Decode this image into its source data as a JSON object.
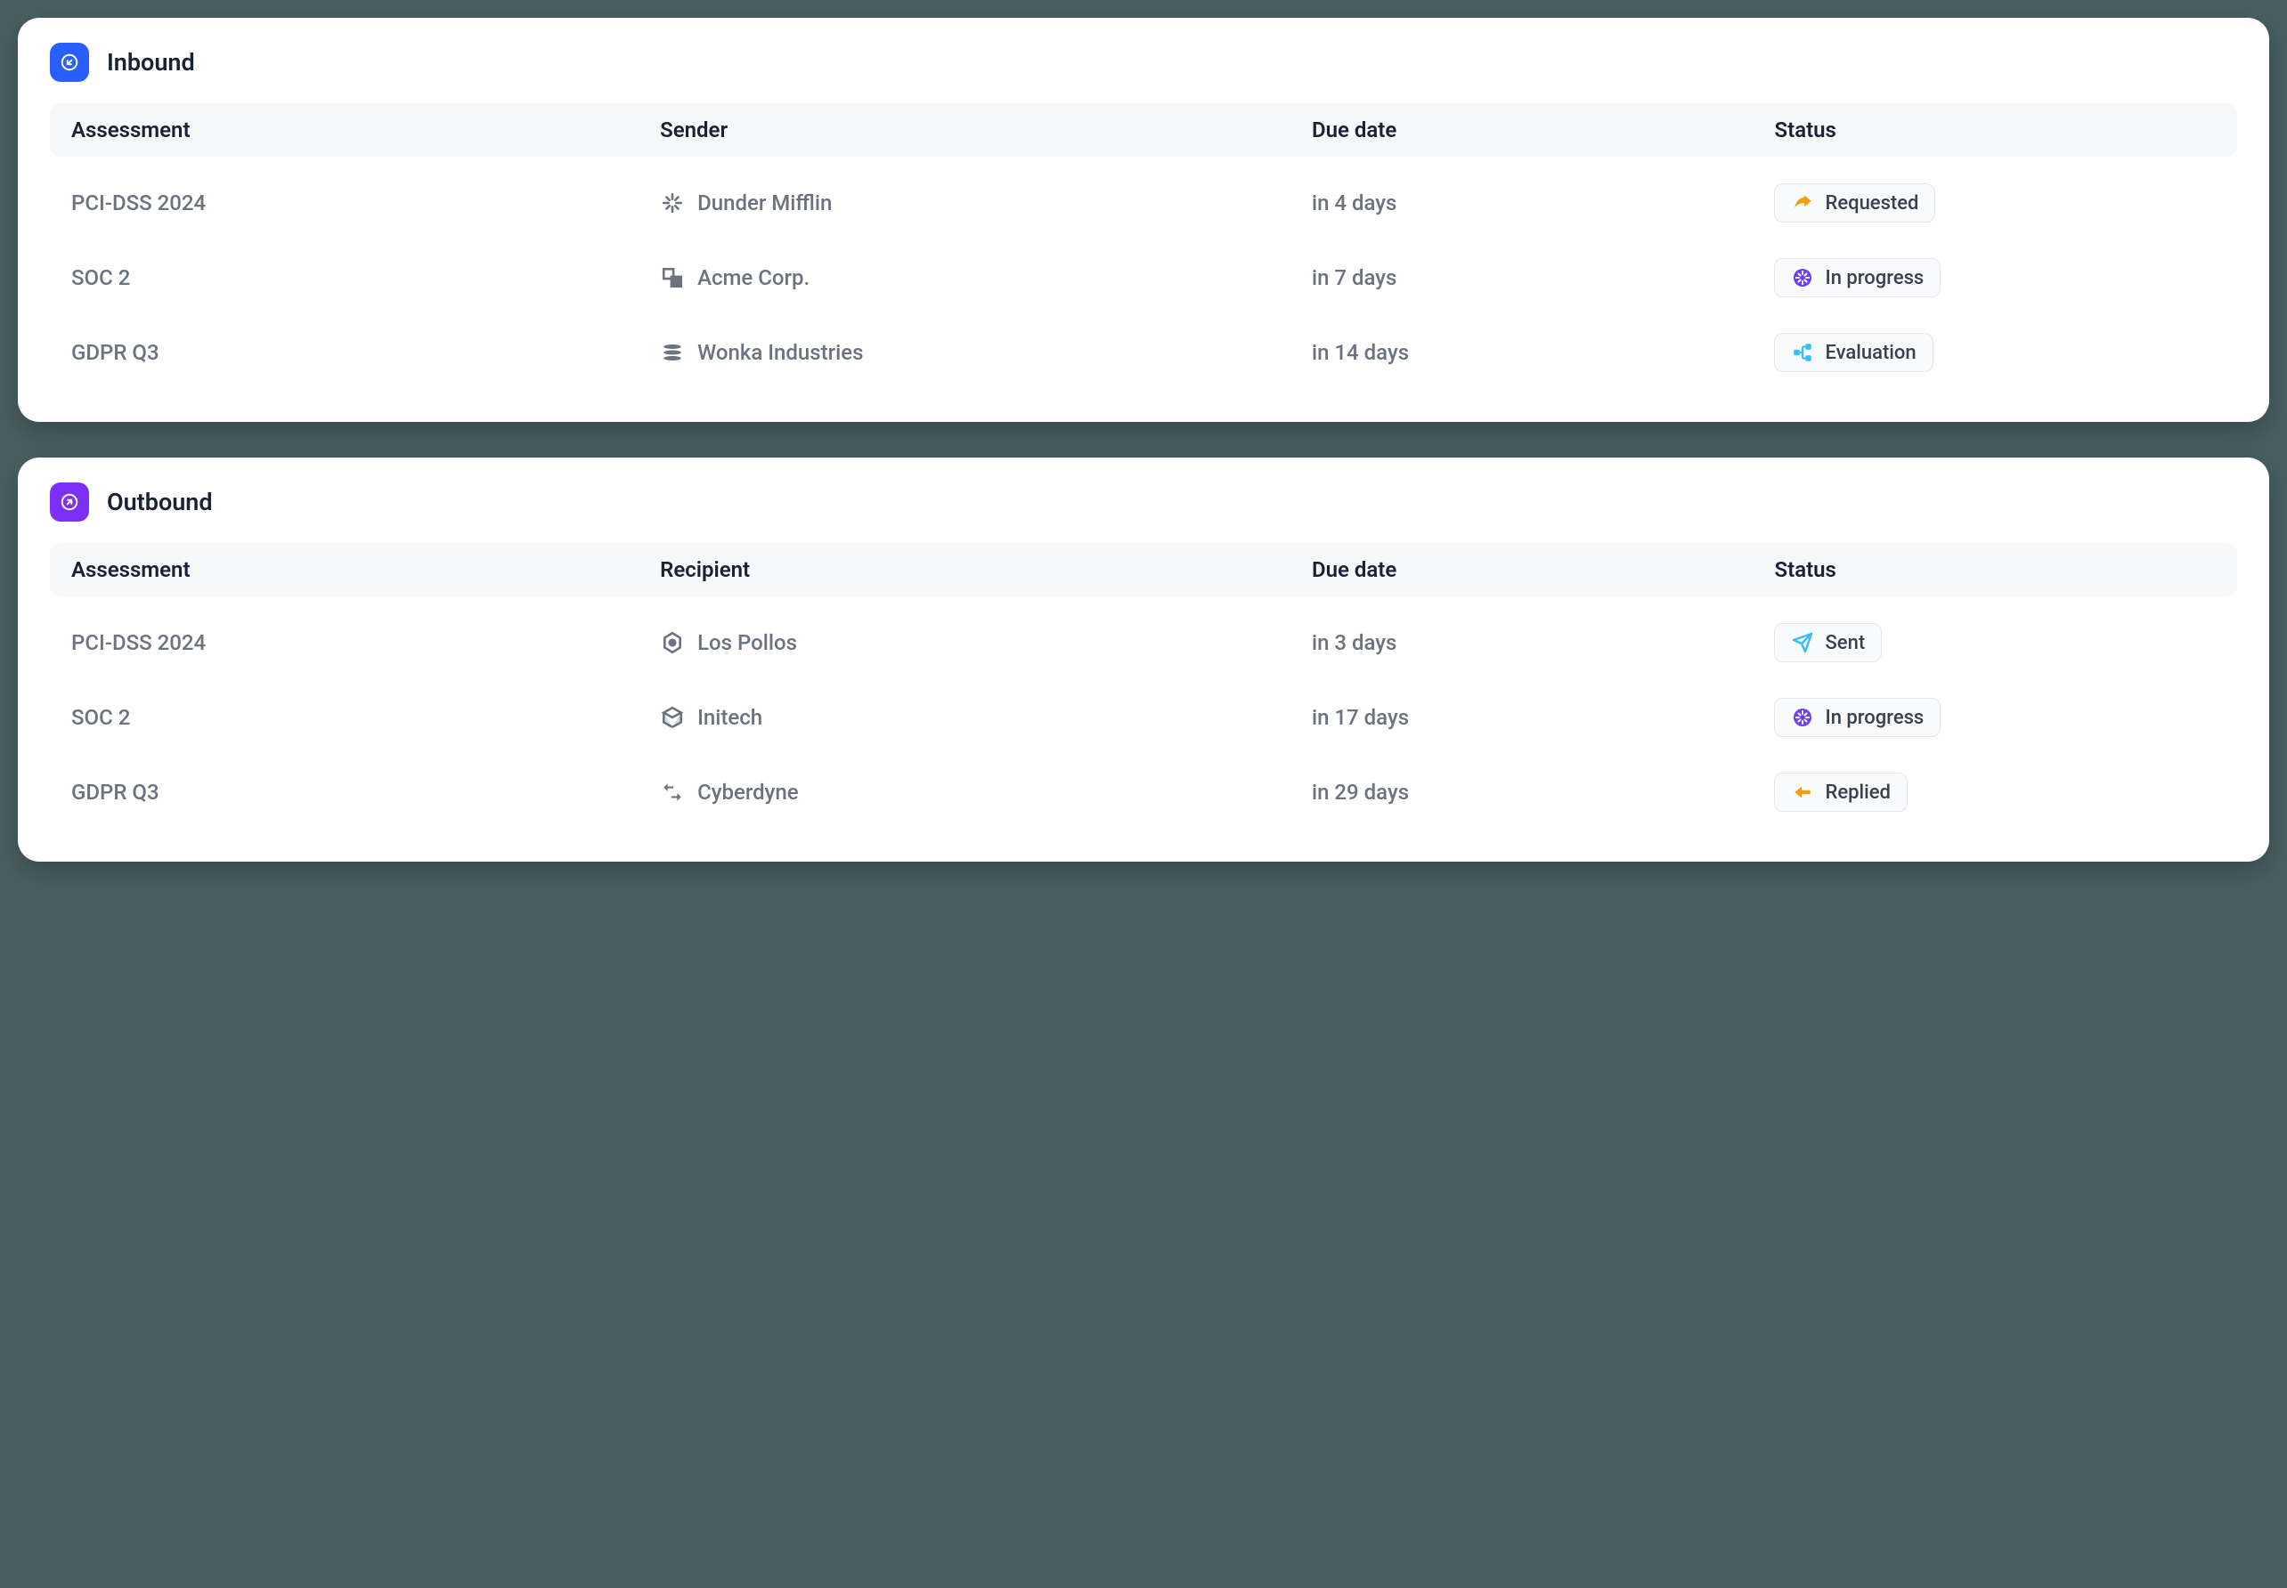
{
  "inbound": {
    "title": "Inbound",
    "columns": {
      "assessment": "Assessment",
      "party": "Sender",
      "due": "Due date",
      "status": "Status"
    },
    "rows": [
      {
        "assessment": "PCI-DSS 2024",
        "party": "Dunder Mifflin",
        "due": "in 4 days",
        "status": "Requested",
        "status_icon": "share",
        "logo_icon": "starburst"
      },
      {
        "assessment": "SOC 2",
        "party": "Acme Corp.",
        "due": "in 7 days",
        "status": "In progress",
        "status_icon": "progress",
        "logo_icon": "shapes"
      },
      {
        "assessment": "GDPR Q3",
        "party": "Wonka Industries",
        "due": "in 14 days",
        "status": "Evaluation",
        "status_icon": "sitemap",
        "logo_icon": "layers"
      }
    ]
  },
  "outbound": {
    "title": "Outbound",
    "columns": {
      "assessment": "Assessment",
      "party": "Recipient",
      "due": "Due date",
      "status": "Status"
    },
    "rows": [
      {
        "assessment": "PCI-DSS 2024",
        "party": "Los Pollos",
        "due": "in 3 days",
        "status": "Sent",
        "status_icon": "send",
        "logo_icon": "target"
      },
      {
        "assessment": "SOC 2",
        "party": "Initech",
        "due": "in 17 days",
        "status": "In progress",
        "status_icon": "progress",
        "logo_icon": "cube"
      },
      {
        "assessment": "GDPR Q3",
        "party": "Cyberdyne",
        "due": "in 29 days",
        "status": "Replied",
        "status_icon": "reply",
        "logo_icon": "arrows"
      }
    ]
  },
  "colors": {
    "inbound_accent": "#295fff",
    "outbound_accent": "#7b2ff7",
    "status_share": "#f59e0b",
    "status_progress": "#6f3ff5",
    "status_sitemap": "#38bdf8",
    "status_send": "#38bdf8",
    "status_reply": "#f59e0b"
  }
}
